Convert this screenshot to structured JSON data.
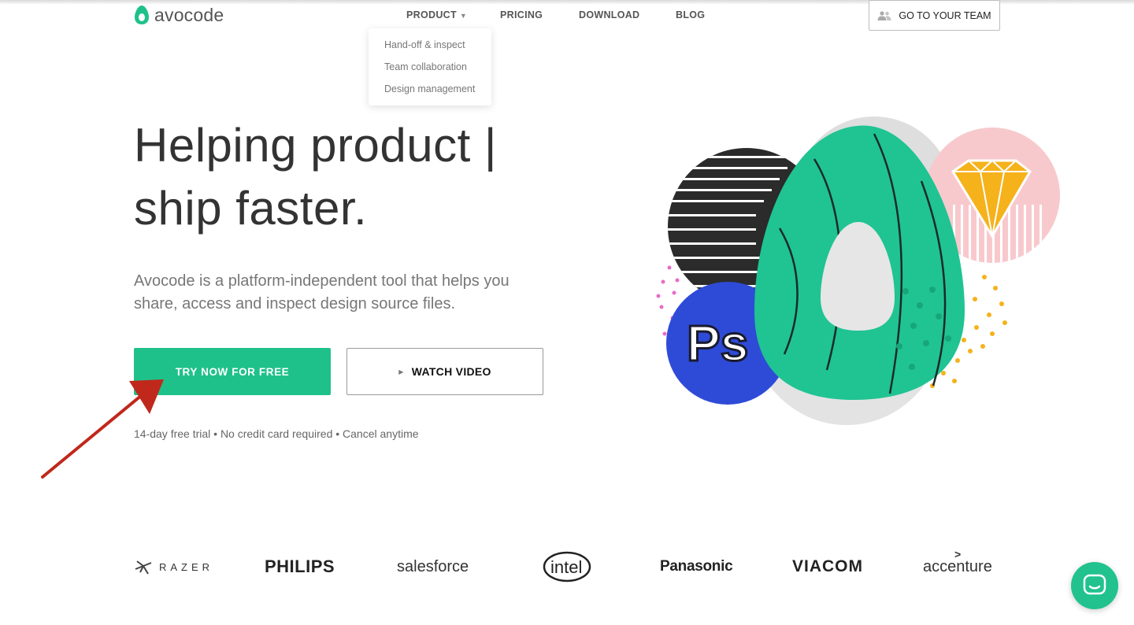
{
  "brand": {
    "name": "avocode",
    "accent": "#1fc18a"
  },
  "nav": {
    "items": [
      {
        "label": "PRODUCT",
        "has_dropdown": true
      },
      {
        "label": "PRICING"
      },
      {
        "label": "DOWNLOAD"
      },
      {
        "label": "BLOG"
      }
    ],
    "team_button": "GO TO YOUR TEAM",
    "team_icon": "users-icon"
  },
  "dropdown": {
    "items": [
      "Hand-off & inspect",
      "Team collaboration",
      "Design management"
    ]
  },
  "hero": {
    "title_line1": "Helping product |",
    "title_line2": "ship faster.",
    "description": "Avocode is a platform-independent tool that helps you share, access and inspect design source files.",
    "primary_button": "TRY NOW FOR FREE",
    "secondary_button": "WATCH VIDEO",
    "secondary_icon": "play-icon",
    "trial_note": "14-day free trial • No credit card required • Cancel anytime"
  },
  "illustration": {
    "badge_text": "Ps"
  },
  "customers": {
    "logos": [
      "RAZER",
      "PHILIPS",
      "salesforce",
      "intel",
      "Panasonic",
      "VIACOM",
      "accenture"
    ]
  },
  "chat": {
    "icon": "chat-icon",
    "color": "#21c28d"
  }
}
